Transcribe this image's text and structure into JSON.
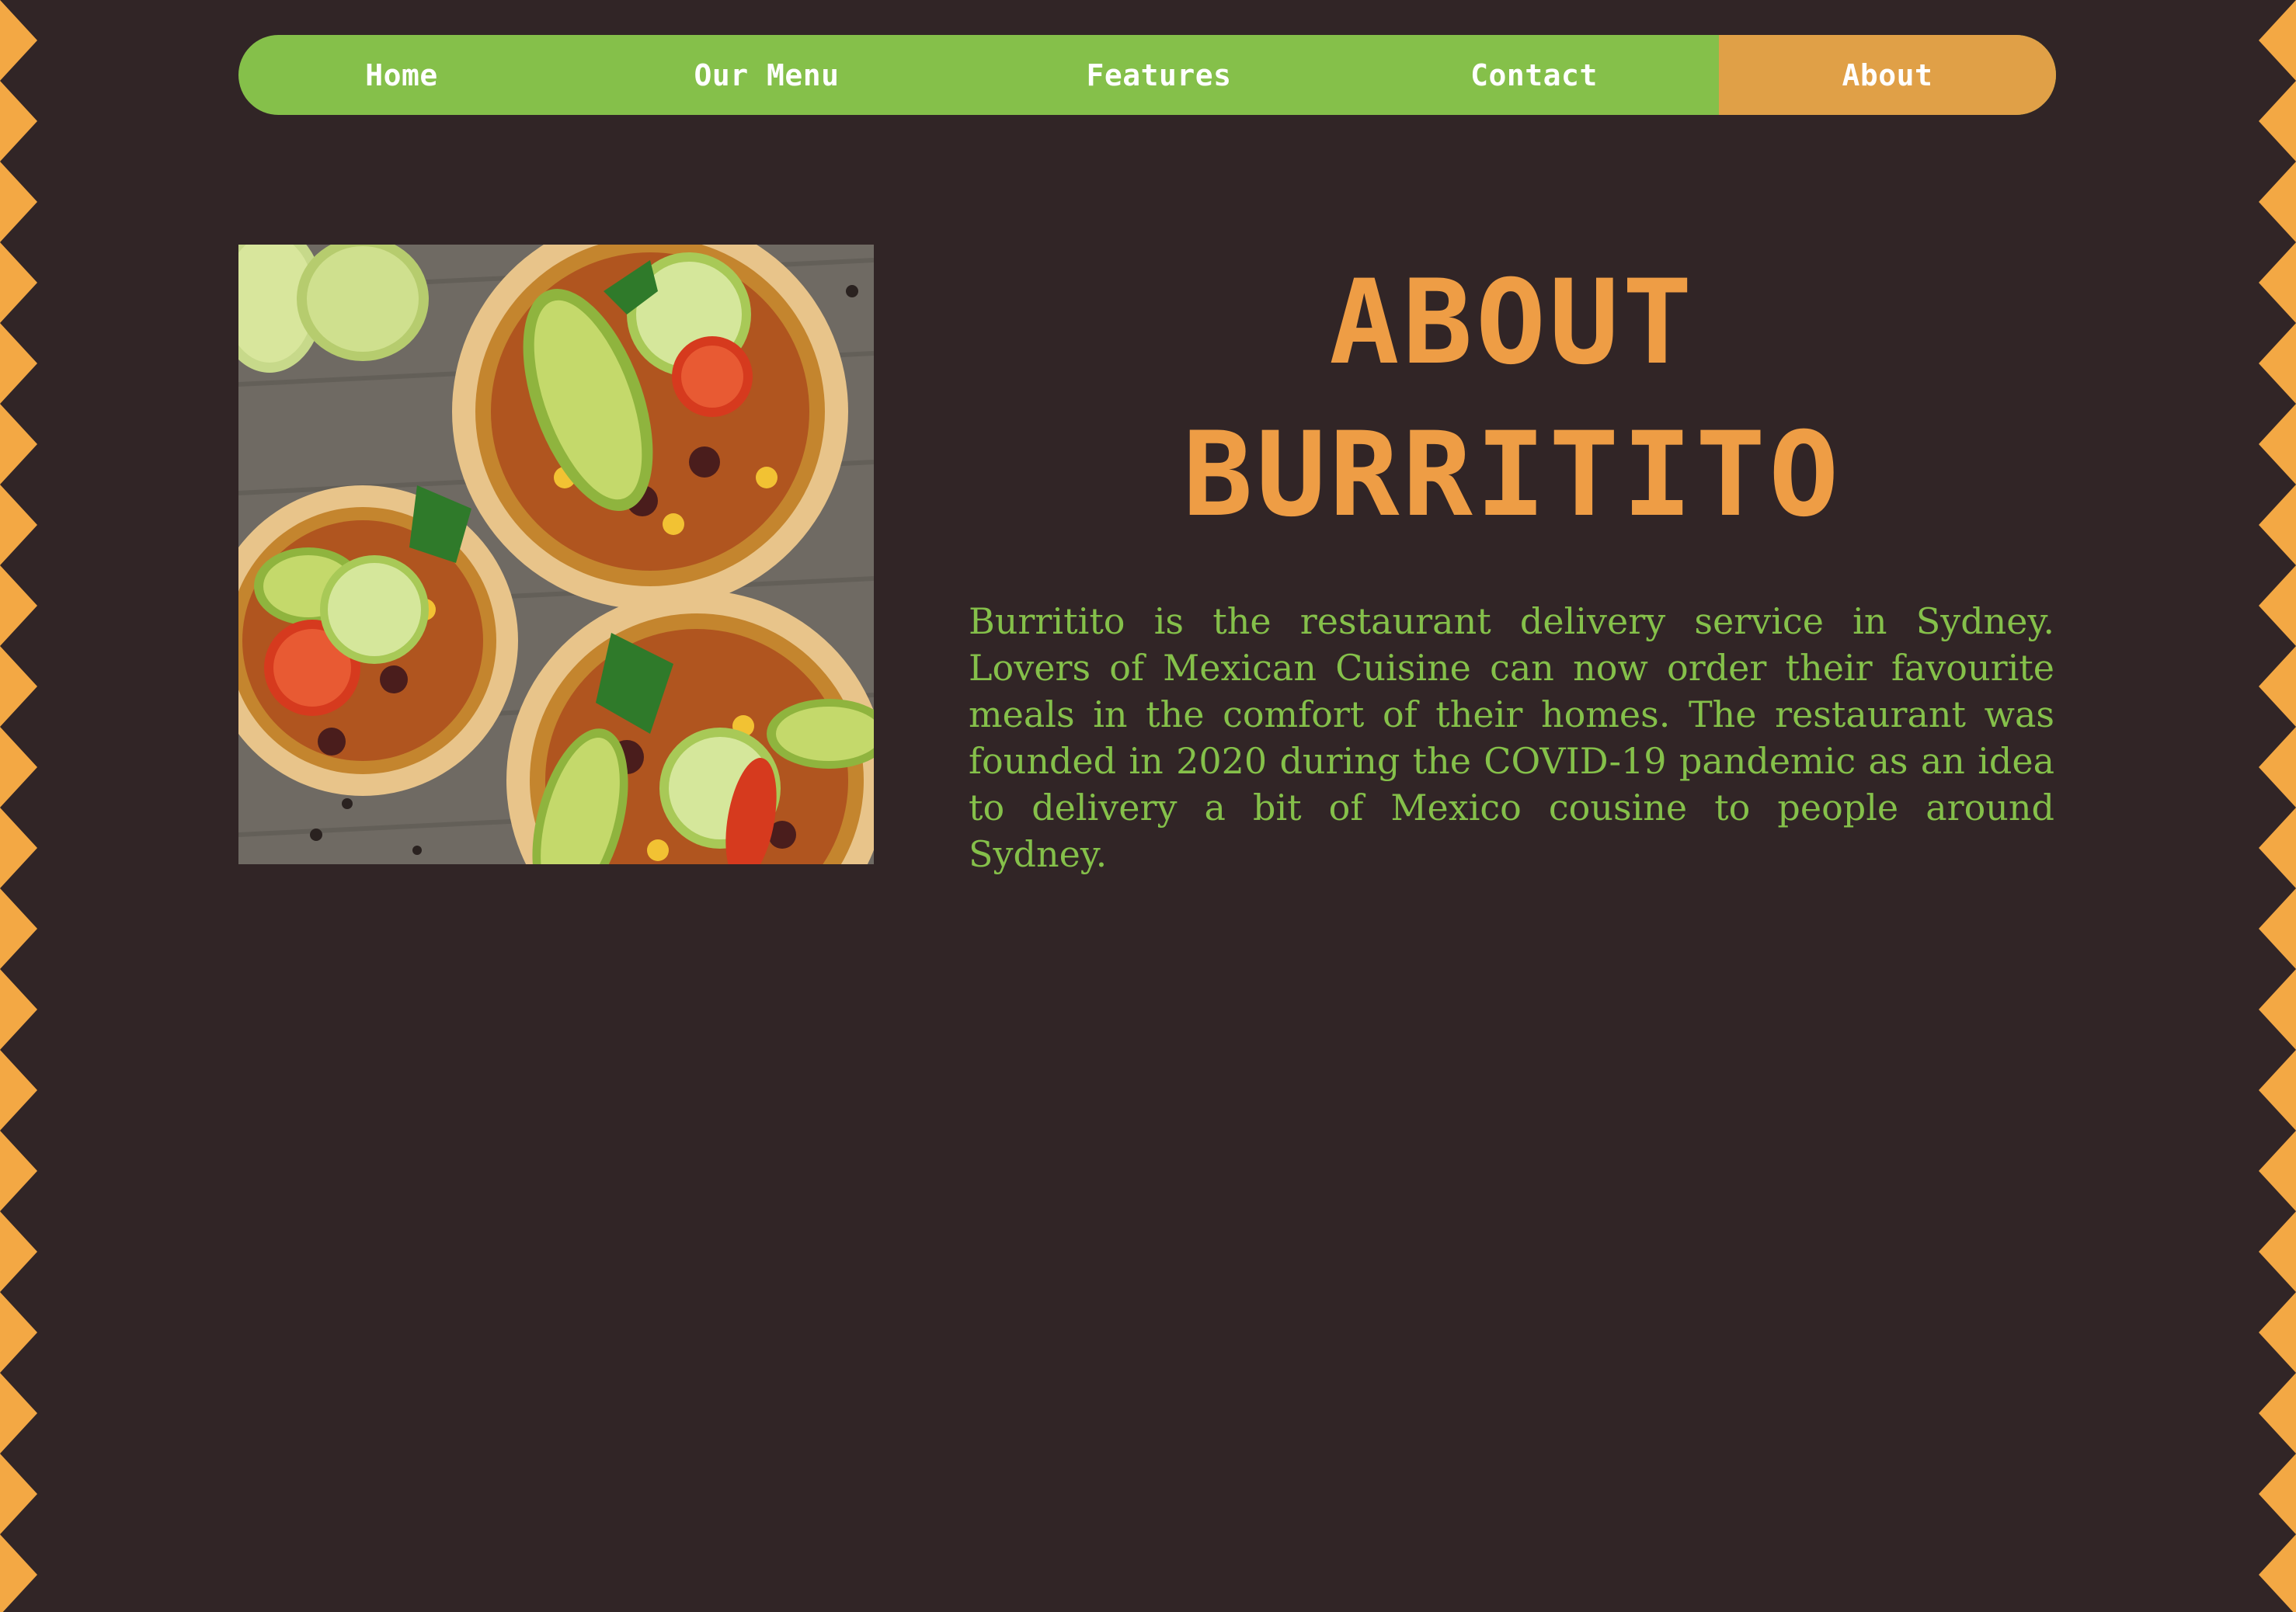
{
  "nav": {
    "items": [
      {
        "label": "Home"
      },
      {
        "label": "Our Menu"
      },
      {
        "label": "Features"
      },
      {
        "label": "Contact"
      },
      {
        "label": "About",
        "active": true
      }
    ]
  },
  "about": {
    "title_line1": "ABOUT",
    "title_line2": "BURRITITO",
    "body": "Burritito is the restaurant delivery service in Sydney. Lovers of Mexican Cuisine can now order their favourite meals in the comfort of their homes. The restaurant was founded in 2020 during the COVID-19 pandemic as an idea to delivery a bit of Mexico cousine to people around Sydney."
  },
  "colors": {
    "background": "#312526",
    "nav_green": "#85c04a",
    "nav_active_orange": "#e0a047",
    "title_orange": "#ee9d45",
    "border_zigzag": "#f3a844",
    "body_text_green": "#85c04a"
  }
}
